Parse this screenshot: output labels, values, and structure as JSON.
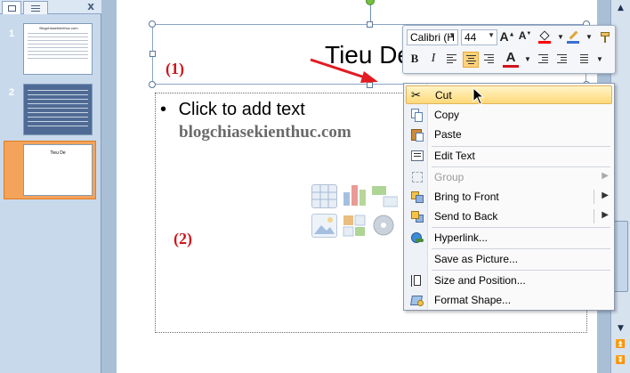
{
  "thumbnails_pane": {
    "tabs": [
      {
        "name": "slides-tab",
        "icon": "slide-icon"
      },
      {
        "name": "outline-tab",
        "icon": "outline-icon"
      }
    ],
    "close_label": "x",
    "slides": [
      {
        "number": "1",
        "title": "Blogchiasekienthuc.com"
      },
      {
        "number": "2",
        "title": ""
      },
      {
        "number": "3",
        "title": "Tieu De"
      }
    ]
  },
  "slide": {
    "title_text": "Tieu De",
    "body_placeholder": "Click to add text",
    "bullet": "•",
    "watermark": "blogchiasekienthuc.com",
    "label_1": "(1)",
    "label_2": "(2)",
    "content_icons": [
      "table-icon",
      "chart-icon",
      "smartart-icon",
      "picture-icon",
      "clipart-icon",
      "media-icon"
    ]
  },
  "mini_toolbar": {
    "font_name": "Calibri (H",
    "font_size": "44",
    "grow_font": "A",
    "shrink_font": "A",
    "bold": "B",
    "italic": "I",
    "font_color_label": "A",
    "font_color": "#d0141c",
    "highlight_color": "#ff0000"
  },
  "context_menu": {
    "items": [
      {
        "label": "Cut",
        "icon": "scissors-icon",
        "enabled": true,
        "highlighted": true
      },
      {
        "label": "Copy",
        "icon": "copy-icon",
        "enabled": true
      },
      {
        "label": "Paste",
        "icon": "paste-icon",
        "enabled": true
      },
      {
        "label": "Edit Text",
        "icon": "edit-text-icon",
        "enabled": true
      },
      {
        "label": "Group",
        "icon": "group-icon",
        "enabled": false,
        "submenu": true
      },
      {
        "label": "Bring to Front",
        "icon": "bring-front-icon",
        "enabled": true,
        "submenu": true
      },
      {
        "label": "Send to Back",
        "icon": "send-back-icon",
        "enabled": true,
        "submenu": true
      },
      {
        "label": "Hyperlink...",
        "icon": "hyperlink-icon",
        "enabled": true
      },
      {
        "label": "Save as Picture...",
        "icon": "",
        "enabled": true
      },
      {
        "label": "Size and Position...",
        "icon": "size-position-icon",
        "enabled": true
      },
      {
        "label": "Format Shape...",
        "icon": "format-shape-icon",
        "enabled": true
      }
    ],
    "submenu_arrow": "▶"
  },
  "scrollbar": {
    "up": "▲",
    "down": "▼",
    "prev_slide": "⏫",
    "next_slide": "⏬"
  },
  "colors": {
    "accent_red": "#d0141c",
    "selection_orange": "#f4a35a",
    "menu_highlight": "#ffd97a"
  }
}
